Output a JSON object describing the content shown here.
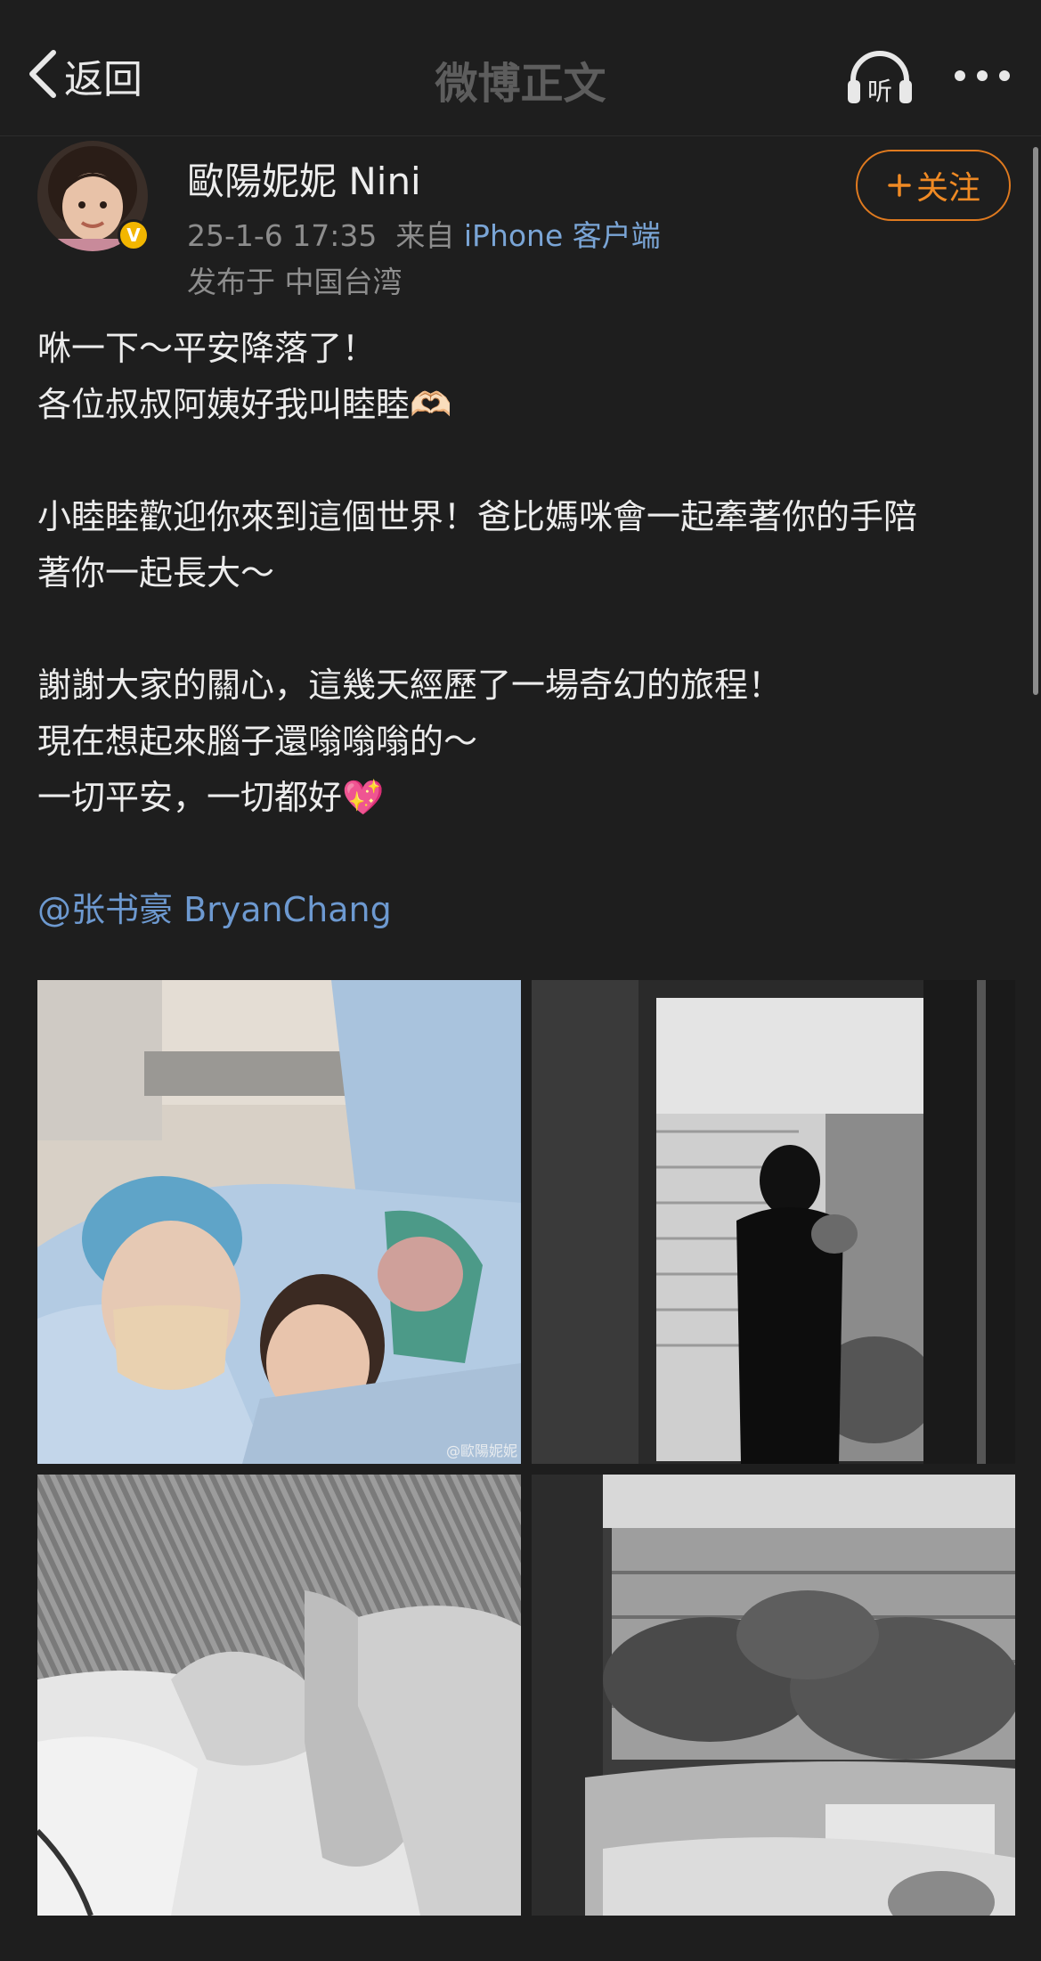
{
  "nav": {
    "back_label": "返回",
    "title": "微博正文",
    "listen_icon_label": "听"
  },
  "author": {
    "name": "歐陽妮妮 Nini",
    "verified_mark": "V",
    "timestamp": "25-1-6 17:35",
    "source_prefix": "来自",
    "source": "iPhone 客户端",
    "location": "发布于 中国台湾",
    "follow_label": "关注"
  },
  "post": {
    "lines": [
      "咻一下～平安降落了！",
      "各位叔叔阿姨好我叫睦睦🫶🏻",
      "",
      "小睦睦歡迎你來到這個世界！爸比媽咪會一起牽著你的手陪",
      "著你一起長大～",
      "",
      "謝謝大家的關心，這幾天經歷了一場奇幻的旅程！",
      "現在想起來腦子還嗡嗡嗡的～",
      "一切平安，一切都好💖",
      ""
    ],
    "mention": "@张书豪 BryanChang"
  },
  "images": {
    "watermark": "@歐陽妮妮"
  },
  "colors": {
    "background": "#1e1e1e",
    "link": "#6d99d0",
    "follow": "#f08a24",
    "verified": "#f2b600"
  }
}
